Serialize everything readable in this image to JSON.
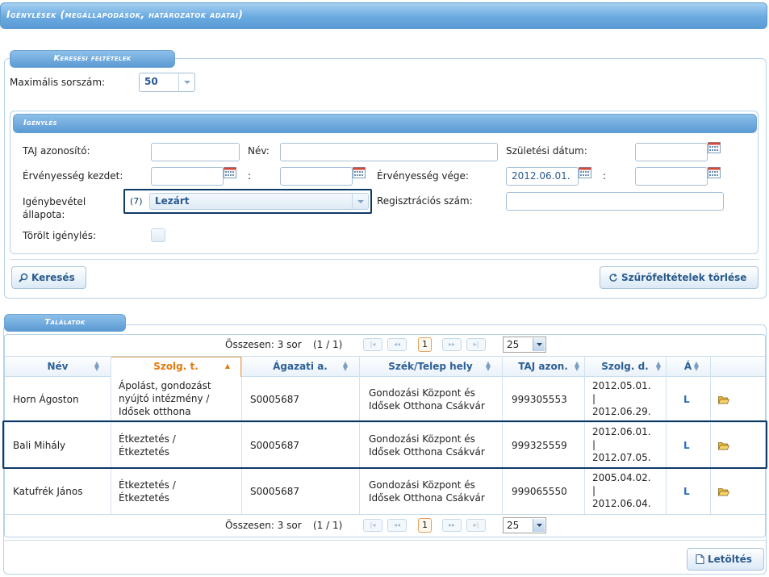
{
  "header": {
    "title": "Igénylések (megállapodások, határozatok adatai)"
  },
  "search": {
    "tab_label": "Keresési feltételek",
    "max_rows_label": "Maximális sorszám:",
    "max_rows_value": "50"
  },
  "claim": {
    "tab_label": "Igénylés",
    "taj_label": "TAJ azonosító:",
    "name_label": "Név:",
    "birth_label": "Születési dátum:",
    "validity_start_label": "Érvényesség kezdet:",
    "range_sep": ":",
    "validity_end_label": "Érvényesség vége:",
    "validity_end_from": "2012.06.01.",
    "status_label": "Igénybevétel állapota:",
    "status_count": "(7)",
    "status_value": "Lezárt",
    "reg_label": "Regisztrációs szám:",
    "deleted_label": "Törölt igénylés:"
  },
  "buttons": {
    "search": "Keresés",
    "clear_filters": "Szűrőfeltételek törlése",
    "download": "Letöltés"
  },
  "results": {
    "tab_label": "Találatok",
    "summary": "Összesen: 3 sor",
    "page_info": "(1 / 1)",
    "page_number": "1",
    "page_size": "25",
    "columns": [
      "Név",
      "Szolg. t.",
      "Ágazati a.",
      "Szék/Telep hely",
      "TAJ azon.",
      "Szolg. d.",
      "Á"
    ],
    "rows": [
      {
        "name": "Horn Ágoston",
        "service_type": "Ápolást, gondozást nyújtó intézmény / Idősek otthona",
        "sector_id": "S0005687",
        "site": "Gondozási Központ és Idősek Otthona Csákvár",
        "taj": "999305553",
        "date_from": "2012.05.01.",
        "date_sep": "|",
        "date_to": "2012.06.29.",
        "status": "L"
      },
      {
        "name": "Bali Mihály",
        "service_type": "Étkeztetés / Étkeztetés",
        "sector_id": "S0005687",
        "site": "Gondozási Központ és Idősek Otthona Csákvár",
        "taj": "999325559",
        "date_from": "2012.06.01.",
        "date_sep": "|",
        "date_to": "2012.07.05.",
        "status": "L"
      },
      {
        "name": "Katufrék János",
        "service_type": "Étkeztetés / Étkeztetés",
        "sector_id": "S0005687",
        "site": "Gondozási Központ és Idősek Otthona Csákvár",
        "taj": "999065550",
        "date_from": "2005.04.02.",
        "date_sep": "|",
        "date_to": "2012.06.04.",
        "status": "L"
      }
    ]
  },
  "colors": {
    "accent": "#5c9cd6",
    "highlight_border": "#0d3a66",
    "sort_active": "#e07a10"
  },
  "icons": {
    "search": "magnifier-icon",
    "clear": "refresh-icon",
    "download": "document-icon",
    "open": "folder-open-icon",
    "calendar": "calendar-icon"
  }
}
